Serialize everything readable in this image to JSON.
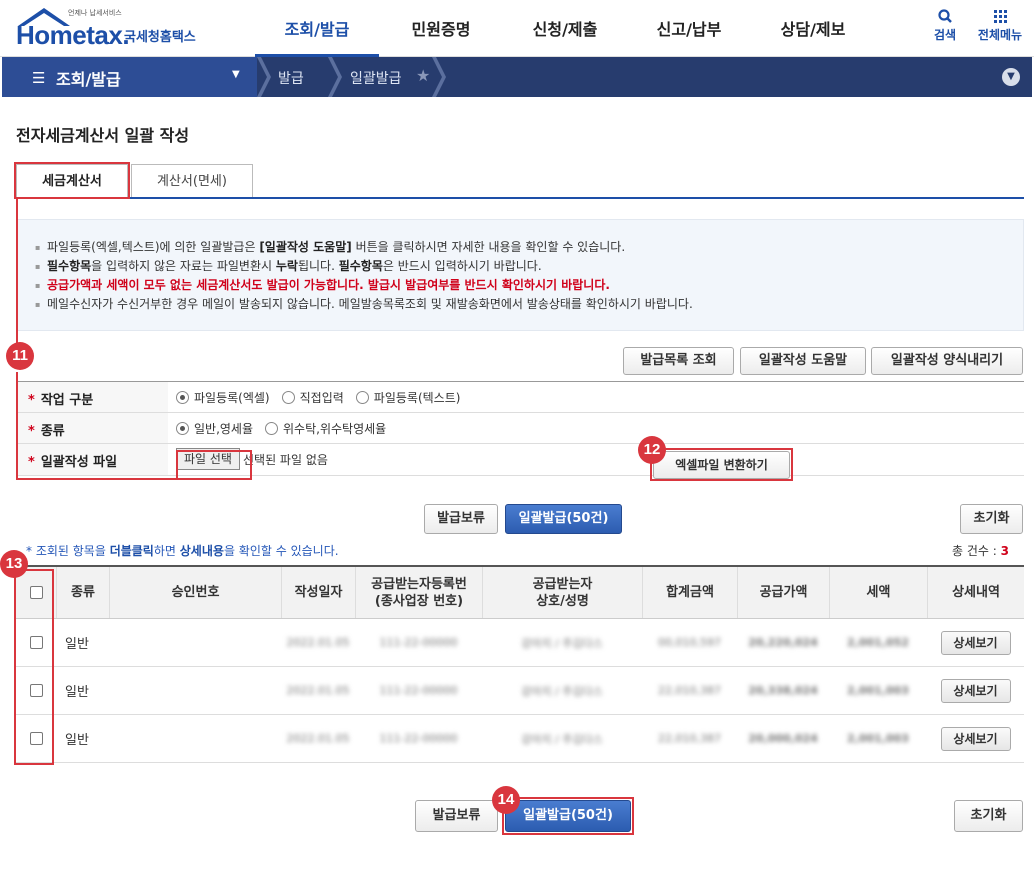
{
  "header": {
    "logo_sub": "언제나 납세서비스",
    "logo_brand": "Hometax.",
    "logo_kr": "국세청홈택스",
    "nav": [
      {
        "label": "조회/발급",
        "active": true
      },
      {
        "label": "민원증명"
      },
      {
        "label": "신청/제출"
      },
      {
        "label": "신고/납부"
      },
      {
        "label": "상담/제보"
      }
    ],
    "search_label": "검색",
    "all_menu_label": "전체메뉴"
  },
  "location": {
    "menu": "조회/발급",
    "crumb1": "발급",
    "crumb2": "일괄발급"
  },
  "page_title": "전자세금계산서 일괄 작성",
  "tabs": [
    {
      "label": "세금계산서",
      "active": true
    },
    {
      "label": "계산서(면세)"
    }
  ],
  "info": {
    "l1_pre": "파일등록(엑셀,텍스트)에 의한 일괄발급은 ",
    "l1_bold": "[일괄작성 도움말]",
    "l1_post": " 버튼을 클릭하시면 자세한 내용을 확인할 수 있습니다.",
    "l2_b1": "필수항목",
    "l2_t1": "을 입력하지 않은 자료는 파일변환시 ",
    "l2_b2": "누락",
    "l2_t2": "됩니다. ",
    "l2_b3": "필수항목",
    "l2_t3": "은 반드시 입력하시기 바랍니다.",
    "l3": "공급가액과 세액이 모두 없는 세금계산서도 발급이 가능합니다. 발급시 발급여부를 반드시 확인하시기 바랍니다.",
    "l4": "메일수신자가 수신거부한 경우 메일이 발송되지 않습니다. 메일발송목록조회 및 재발송화면에서 발송상태를 확인하시기 바랍니다."
  },
  "top_buttons": {
    "list": "발급목록 조회",
    "help": "일괄작성 도움말",
    "download": "일괄작성 양식내리기"
  },
  "form": {
    "star": "*",
    "work_type_label": "작업 구분",
    "work_type_options": [
      "파일등록(엑셀)",
      "직접입력",
      "파일등록(텍스트)"
    ],
    "kind_label": "종류",
    "kind_options": [
      "일반,영세율",
      "위수탁,위수탁영세율"
    ],
    "file_label": "일괄작성 파일",
    "file_button": "파일 선택",
    "file_status": "선택된 파일 없음",
    "convert_button": "엑셀파일 변환하기"
  },
  "actions": {
    "hold": "발급보류",
    "issue": "일괄발급(50건)",
    "reset": "초기화"
  },
  "grid": {
    "note_pre": "* 조회된 항목을 ",
    "note_b1": "더블클릭",
    "note_mid": "하면 ",
    "note_b2": "상세내용",
    "note_post": "을 확인할 수 있습니다.",
    "total_label": "총 건수 :",
    "total_count": "3",
    "headers": [
      "종류",
      "승인번호",
      "작성일자",
      "공급받는자등록번\n(종사업장 번호)",
      "공급받는자\n상호/성명",
      "합계금액",
      "공급가액",
      "세액",
      "상세내역"
    ],
    "detail_button": "상세보기",
    "rows": [
      {
        "kind": "일반",
        "date": "2022.01.05",
        "reg": "111-22-00000",
        "name": "강아지 / 주김다스",
        "total": "00,010,597",
        "supply": "20,220,024",
        "tax": "2,001,052"
      },
      {
        "kind": "일반",
        "date": "2022.01.05",
        "reg": "111-22-00000",
        "name": "강아지 / 주김다스",
        "total": "22,010,387",
        "supply": "20,338,024",
        "tax": "2,001,003"
      },
      {
        "kind": "일반",
        "date": "2022.01.05",
        "reg": "111-22-00000",
        "name": "강아지 / 주김다스",
        "total": "22,010,387",
        "supply": "20,000,024",
        "tax": "2,001,003"
      }
    ]
  },
  "markers": [
    "11",
    "12",
    "13",
    "14"
  ],
  "colors": {
    "brand": "#1d4fa8",
    "location_bar": "#273c6e",
    "annotation": "#d9363e",
    "alert": "#d0021b"
  }
}
